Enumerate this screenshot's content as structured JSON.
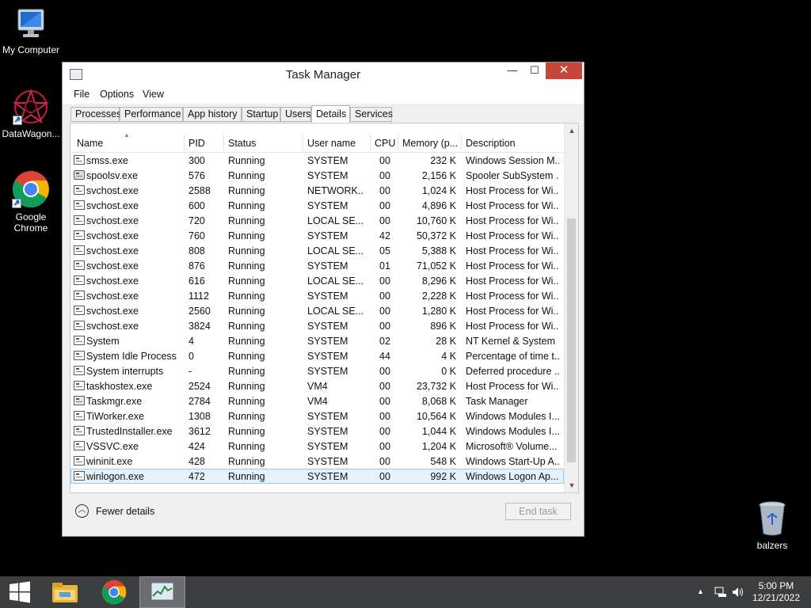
{
  "desktop": {
    "icons": [
      {
        "label": "My Computer"
      },
      {
        "label": "DataWagon..."
      },
      {
        "label_line1": "Google",
        "label_line2": "Chrome"
      },
      {
        "label": "balzers"
      }
    ]
  },
  "window": {
    "title": "Task Manager",
    "controls": {
      "minimize": "—",
      "maximize": "☐",
      "close": "✕"
    },
    "menu": [
      "File",
      "Options",
      "View"
    ],
    "tabs": [
      "Processes",
      "Performance",
      "App history",
      "Startup",
      "Users",
      "Details",
      "Services"
    ],
    "active_tab": "Details",
    "columns": [
      "Name",
      "PID",
      "Status",
      "User name",
      "CPU",
      "Memory (p...",
      "Description"
    ],
    "rows": [
      {
        "name": "smss.exe",
        "pid": "300",
        "status": "Running",
        "user": "SYSTEM",
        "cpu": "00",
        "mem": "232 K",
        "desc": "Windows Session M..."
      },
      {
        "name": "spoolsv.exe",
        "pid": "576",
        "status": "Running",
        "user": "SYSTEM",
        "cpu": "00",
        "mem": "2,156 K",
        "desc": "Spooler SubSystem ..."
      },
      {
        "name": "svchost.exe",
        "pid": "2588",
        "status": "Running",
        "user": "NETWORK...",
        "cpu": "00",
        "mem": "1,024 K",
        "desc": "Host Process for Wi..."
      },
      {
        "name": "svchost.exe",
        "pid": "600",
        "status": "Running",
        "user": "SYSTEM",
        "cpu": "00",
        "mem": "4,896 K",
        "desc": "Host Process for Wi..."
      },
      {
        "name": "svchost.exe",
        "pid": "720",
        "status": "Running",
        "user": "LOCAL SE...",
        "cpu": "00",
        "mem": "10,760 K",
        "desc": "Host Process for Wi..."
      },
      {
        "name": "svchost.exe",
        "pid": "760",
        "status": "Running",
        "user": "SYSTEM",
        "cpu": "42",
        "mem": "50,372 K",
        "desc": "Host Process for Wi..."
      },
      {
        "name": "svchost.exe",
        "pid": "808",
        "status": "Running",
        "user": "LOCAL SE...",
        "cpu": "05",
        "mem": "5,388 K",
        "desc": "Host Process for Wi..."
      },
      {
        "name": "svchost.exe",
        "pid": "876",
        "status": "Running",
        "user": "SYSTEM",
        "cpu": "01",
        "mem": "71,052 K",
        "desc": "Host Process for Wi..."
      },
      {
        "name": "svchost.exe",
        "pid": "616",
        "status": "Running",
        "user": "LOCAL SE...",
        "cpu": "00",
        "mem": "8,296 K",
        "desc": "Host Process for Wi..."
      },
      {
        "name": "svchost.exe",
        "pid": "1112",
        "status": "Running",
        "user": "SYSTEM",
        "cpu": "00",
        "mem": "2,228 K",
        "desc": "Host Process for Wi..."
      },
      {
        "name": "svchost.exe",
        "pid": "2560",
        "status": "Running",
        "user": "LOCAL SE...",
        "cpu": "00",
        "mem": "1,280 K",
        "desc": "Host Process for Wi..."
      },
      {
        "name": "svchost.exe",
        "pid": "3824",
        "status": "Running",
        "user": "SYSTEM",
        "cpu": "00",
        "mem": "896 K",
        "desc": "Host Process for Wi..."
      },
      {
        "name": "System",
        "pid": "4",
        "status": "Running",
        "user": "SYSTEM",
        "cpu": "02",
        "mem": "28 K",
        "desc": "NT Kernel & System"
      },
      {
        "name": "System Idle Process",
        "pid": "0",
        "status": "Running",
        "user": "SYSTEM",
        "cpu": "44",
        "mem": "4 K",
        "desc": "Percentage of time t..."
      },
      {
        "name": "System interrupts",
        "pid": "-",
        "status": "Running",
        "user": "SYSTEM",
        "cpu": "00",
        "mem": "0 K",
        "desc": "Deferred procedure ..."
      },
      {
        "name": "taskhostex.exe",
        "pid": "2524",
        "status": "Running",
        "user": "VM4",
        "cpu": "00",
        "mem": "23,732 K",
        "desc": "Host Process for Wi..."
      },
      {
        "name": "Taskmgr.exe",
        "pid": "2784",
        "status": "Running",
        "user": "VM4",
        "cpu": "00",
        "mem": "8,068 K",
        "desc": "Task Manager"
      },
      {
        "name": "TiWorker.exe",
        "pid": "1308",
        "status": "Running",
        "user": "SYSTEM",
        "cpu": "00",
        "mem": "10,564 K",
        "desc": "Windows Modules I..."
      },
      {
        "name": "TrustedInstaller.exe",
        "pid": "3612",
        "status": "Running",
        "user": "SYSTEM",
        "cpu": "00",
        "mem": "1,044 K",
        "desc": "Windows Modules I..."
      },
      {
        "name": "VSSVC.exe",
        "pid": "424",
        "status": "Running",
        "user": "SYSTEM",
        "cpu": "00",
        "mem": "1,204 K",
        "desc": "Microsoft® Volume..."
      },
      {
        "name": "wininit.exe",
        "pid": "428",
        "status": "Running",
        "user": "SYSTEM",
        "cpu": "00",
        "mem": "548 K",
        "desc": "Windows Start-Up A..."
      },
      {
        "name": "winlogon.exe",
        "pid": "472",
        "status": "Running",
        "user": "SYSTEM",
        "cpu": "00",
        "mem": "992 K",
        "desc": "Windows Logon Ap..."
      }
    ],
    "selected_row": 21,
    "footer": {
      "fewer_details": "Fewer details",
      "end_task": "End task"
    }
  },
  "taskbar": {
    "clock_time": "5:00 PM",
    "clock_date": "12/21/2022",
    "tray_chevron": "▲"
  },
  "colors": {
    "close_button": "#c7463c",
    "selection": "#e6f2fb",
    "taskbar": "#3c3d3f"
  },
  "icons": [
    "computer-icon",
    "datawagon-icon",
    "chrome-icon",
    "recycle-bin-icon",
    "windows-start-icon",
    "file-explorer-icon",
    "task-manager-icon",
    "network-icon",
    "volume-icon"
  ]
}
